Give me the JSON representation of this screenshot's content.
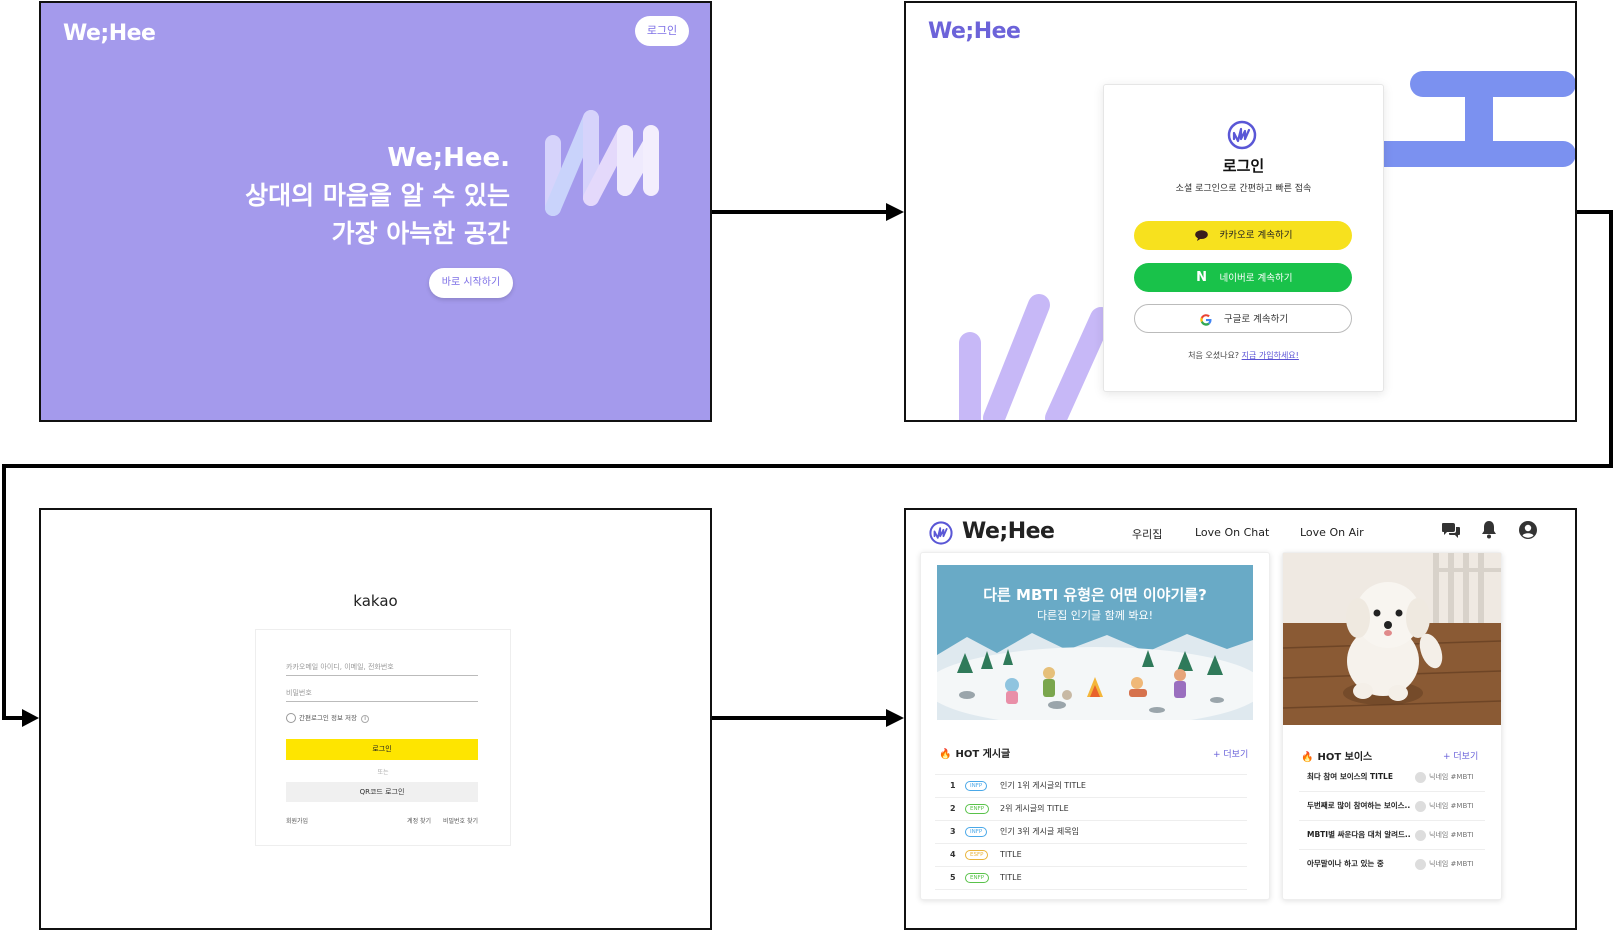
{
  "screen1": {
    "logo": "We;Hee",
    "login_button": "로그인",
    "hero_line1": "We;Hee.",
    "hero_line2": "상대의 마음을 알 수 있는",
    "hero_line3": "가장 아늑한 공간",
    "start_button": "바로 시작하기",
    "background_color": "#a49aec"
  },
  "screen2": {
    "logo": "We;Hee",
    "title": "로그인",
    "subtitle": "소셜 로그인으로 간편하고 빠른 접속",
    "kakao_button": "카카오로 계속하기",
    "naver_button": "네이버로 계속하기",
    "google_button": "구글로 계속하기",
    "signup_prompt": "처음 오셨나요?",
    "signup_link": "지금 가입하세요!",
    "icons": [
      "chat-bubble-icon",
      "naver-n-icon",
      "google-g-icon",
      "wehee-logo-icon"
    ]
  },
  "screen3": {
    "brand": "kakao",
    "id_placeholder": "카카오메일 아이디, 이메일, 전화번호",
    "pw_placeholder": "비밀번호",
    "save_login": "간편로그인 정보 저장",
    "login_button": "로그인",
    "or": "또는",
    "qr_button": "QR코드 로그인",
    "signup": "회원가입",
    "find_account": "계정 찾기",
    "find_password": "비밀번호 찾기"
  },
  "screen4": {
    "logo": "We;Hee",
    "nav": [
      "우리집",
      "Love On Chat",
      "Love On Air"
    ],
    "header_icons": [
      "chat-icon",
      "bell-icon",
      "user-icon"
    ],
    "banner_title": "다른 MBTI 유형은 어떤 이야기를?",
    "banner_subtitle": "다른집 인기글 함께 봐요!",
    "hot_posts_title": "HOT 게시글",
    "hot_posts_more": "+ 더보기",
    "hot_posts": [
      {
        "rank": "1",
        "tag": "INFP",
        "tag_color": "#4aa8e8",
        "title": "인기 1위 게시글의 TITLE"
      },
      {
        "rank": "2",
        "tag": "ENFP",
        "tag_color": "#59c24a",
        "title": "2위 게시글의 TITLE"
      },
      {
        "rank": "3",
        "tag": "INFP",
        "tag_color": "#4aa8e8",
        "title": "인기 3위 게시글 제목임"
      },
      {
        "rank": "4",
        "tag": "ESFP",
        "tag_color": "#e9b43a",
        "title": "TITLE"
      },
      {
        "rank": "5",
        "tag": "ENFP",
        "tag_color": "#59c24a",
        "title": "TITLE"
      }
    ],
    "hot_voice_title": "HOT 보이스",
    "hot_voice_more": "+ 더보기",
    "hot_voices": [
      {
        "title": "최다 참여 보이스의 TITLE",
        "nick": "닉네임 #MBTI"
      },
      {
        "title": "두번째로 많이 참여하는 보이스..",
        "nick": "닉네임 #MBTI"
      },
      {
        "title": "MBTI별 싸운다음 대처 알려드..",
        "nick": "닉네임 #MBTI"
      },
      {
        "title": "아무말이나 하고 있는 중",
        "nick": "닉네임 #MBTI"
      }
    ],
    "accent_color": "#6a62d9"
  }
}
